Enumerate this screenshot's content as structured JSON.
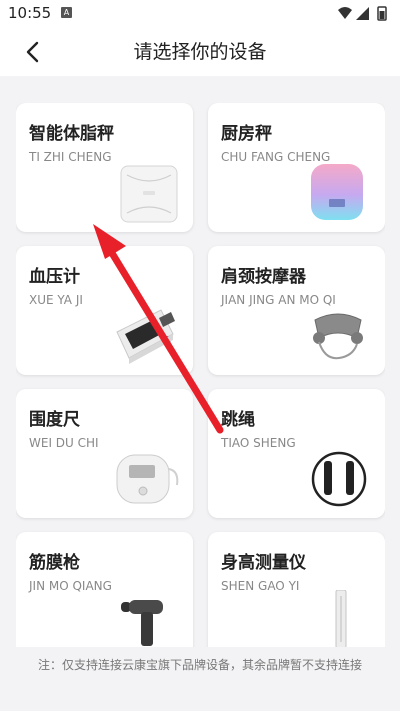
{
  "status_bar": {
    "time": "10:55",
    "notification_letter": "A"
  },
  "header": {
    "title": "请选择你的设备"
  },
  "devices": [
    {
      "name": "智能体脂秤",
      "pinyin": "TI ZHI CHENG",
      "icon": "body-fat-scale-icon"
    },
    {
      "name": "厨房秤",
      "pinyin": "CHU FANG CHENG",
      "icon": "kitchen-scale-icon"
    },
    {
      "name": "血压计",
      "pinyin": "XUE YA JI",
      "icon": "blood-pressure-monitor-icon"
    },
    {
      "name": "肩颈按摩器",
      "pinyin": "JIAN JING AN MO QI",
      "icon": "neck-massager-icon"
    },
    {
      "name": "围度尺",
      "pinyin": "WEI DU CHI",
      "icon": "tape-measure-icon"
    },
    {
      "name": "跳绳",
      "pinyin": "TIAO SHENG",
      "icon": "jump-rope-icon"
    },
    {
      "name": "筋膜枪",
      "pinyin": "JIN MO QIANG",
      "icon": "massage-gun-icon"
    },
    {
      "name": "身高测量仪",
      "pinyin": "SHEN GAO YI",
      "icon": "height-meter-icon"
    }
  ],
  "note": "注：仅支持连接云康宝旗下品牌设备，其余品牌暂不支持连接",
  "colors": {
    "arrow": "#e8202a",
    "kitchen_scale_top": "#f5a9c8",
    "kitchen_scale_bottom": "#7fe0f0"
  }
}
